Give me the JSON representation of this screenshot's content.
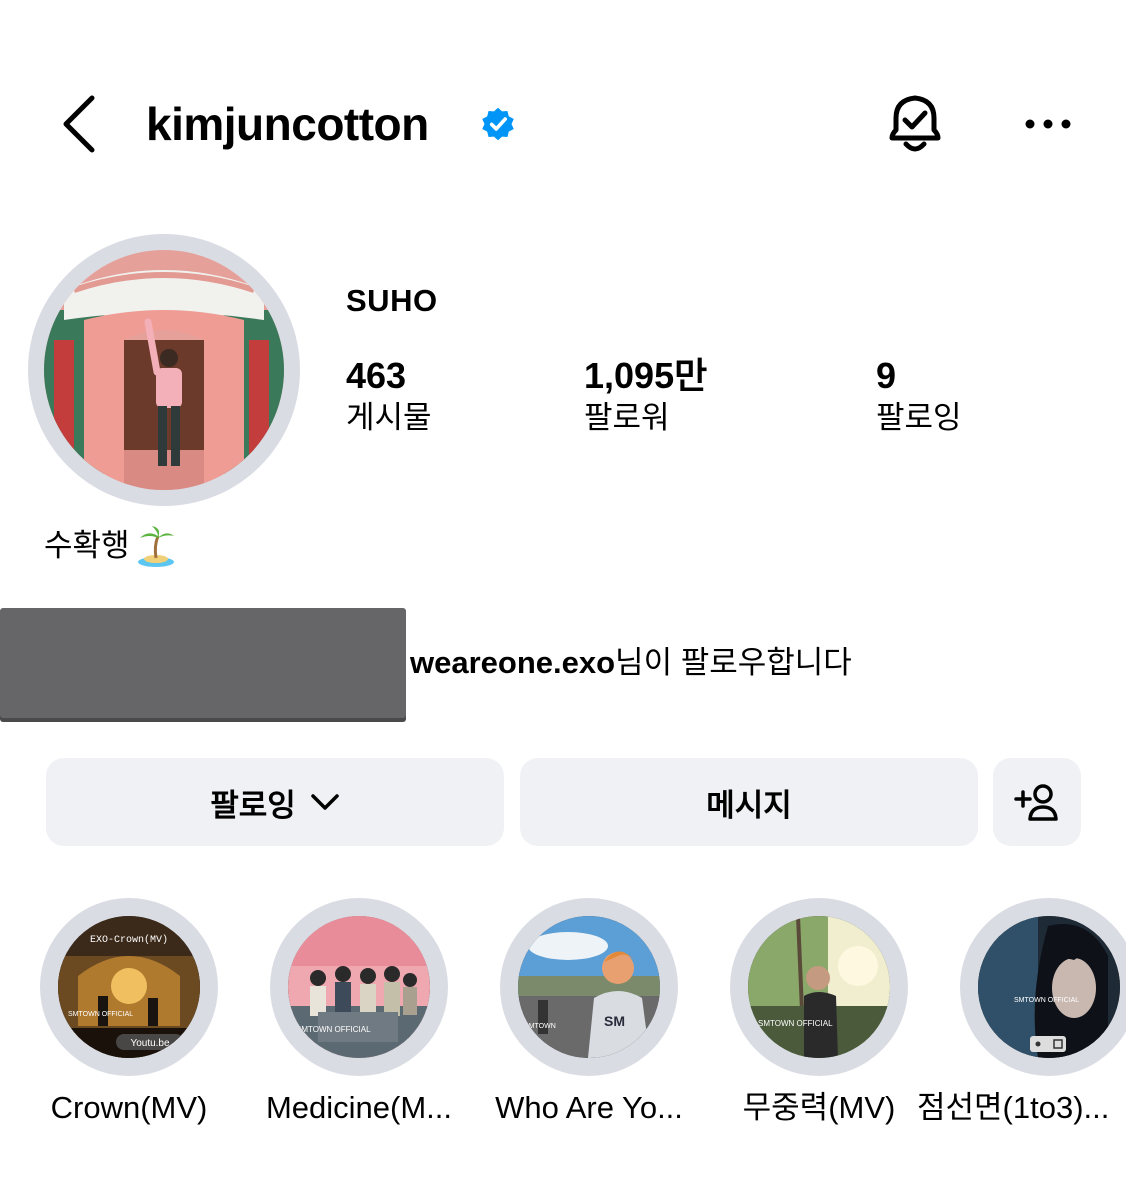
{
  "header": {
    "username": "kimjuncotton",
    "back_icon": "chevron-left-icon",
    "verified_icon": "verified-badge-icon",
    "bell_icon": "bell-check-icon",
    "more_icon": "more-horizontal-icon",
    "verified_color": "#0095f6"
  },
  "profile": {
    "display_name": "SUHO",
    "stats": {
      "posts": {
        "value": "463",
        "label": "게시물"
      },
      "followers": {
        "value": "1,095만",
        "label": "팔로워"
      },
      "following": {
        "value": "9",
        "label": "팔로잉"
      }
    },
    "bio": "수확행",
    "bio_emoji": "desert-island-emoji",
    "followed_by": {
      "account": "weareone.exo",
      "suffix": "님이 팔로우합니다"
    }
  },
  "actions": {
    "following_label": "팔로잉",
    "message_label": "메시지",
    "add_user_icon": "add-user-icon",
    "button_bg": "#eff1f4"
  },
  "highlights": [
    {
      "label": "Crown(MV)",
      "overlay_title": "EXO-Crown(MV)",
      "overlay_source": "Youtu.be",
      "watermark": "SMTOWN OFFICIAL"
    },
    {
      "label": "Medicine(M...",
      "watermark": "SMTOWN OFFICIAL"
    },
    {
      "label": "Who Are Yo...",
      "watermark": "SMTOWN"
    },
    {
      "label": "무중력(MV)",
      "watermark": "SMTOWN OFFICIAL"
    },
    {
      "label": "점선면(1to3)...",
      "watermark": "SMTOWN OFFICIAL"
    }
  ]
}
